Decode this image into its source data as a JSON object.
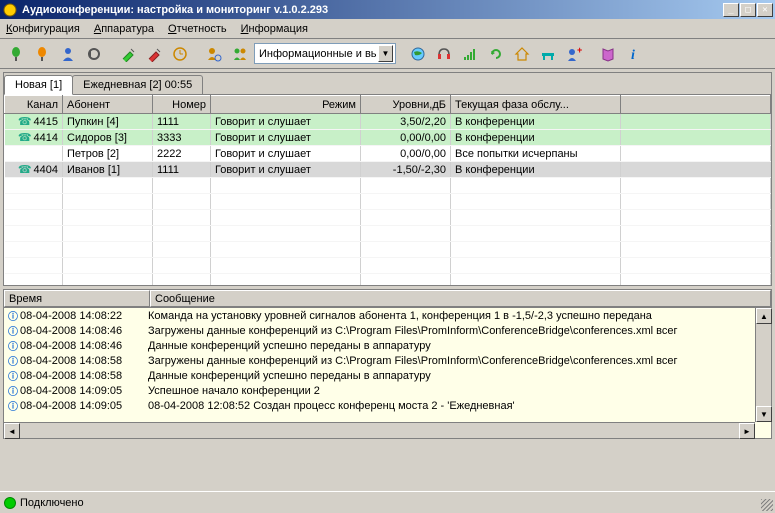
{
  "title": "Аудиоконференции: настройка и мониторинг v.1.0.2.293",
  "menu": {
    "config": "Конфигурация",
    "hardware": "Аппаратура",
    "report": "Отчетность",
    "info": "Информация"
  },
  "toolbar": {
    "combo_value": "Информационные и вь"
  },
  "tabs": [
    {
      "label": "Новая [1]",
      "active": true
    },
    {
      "label": "Ежедневная [2] 00:55",
      "active": false
    }
  ],
  "columns": {
    "channel": "Канал",
    "abonent": "Абонент",
    "number": "Номер",
    "mode": "Режим",
    "levels": "Уровни,дБ",
    "phase": "Текущая фаза обслу..."
  },
  "rows": [
    {
      "style": "green",
      "icon": true,
      "channel": "4415",
      "abonent": "Пупкин [4]",
      "number": "1111",
      "mode": "Говорит и слушает",
      "levels": "3,50/2,20",
      "phase": "В конференции"
    },
    {
      "style": "green",
      "icon": true,
      "channel": "4414",
      "abonent": "Сидоров [3]",
      "number": "3333",
      "mode": "Говорит и слушает",
      "levels": "0,00/0,00",
      "phase": "В конференции"
    },
    {
      "style": "white",
      "icon": false,
      "channel": "",
      "abonent": "Петров [2]",
      "number": "2222",
      "mode": "Говорит и слушает",
      "levels": "0,00/0,00",
      "phase": "Все попытки исчерпаны"
    },
    {
      "style": "gray",
      "icon": true,
      "channel": "4404",
      "abonent": "Иванов [1]",
      "number": "1111",
      "mode": "Говорит и слушает",
      "levels": "-1,50/-2,30",
      "phase": "В конференции"
    }
  ],
  "log_columns": {
    "time": "Время",
    "msg": "Сообщение"
  },
  "log": [
    {
      "time": "08-04-2008 14:08:22",
      "msg": "Команда на установку уровней сигналов абонента 1, конференция 1 в -1,5/-2,3 успешно передана"
    },
    {
      "time": "08-04-2008 14:08:46",
      "msg": "Загружены данные конференций из C:\\Program Files\\PromInform\\ConferenceBridge\\conferences.xml всег"
    },
    {
      "time": "08-04-2008 14:08:46",
      "msg": "Данные конференций успешно переданы в аппаратуру"
    },
    {
      "time": "08-04-2008 14:08:58",
      "msg": "Загружены данные конференций из C:\\Program Files\\PromInform\\ConferenceBridge\\conferences.xml всег"
    },
    {
      "time": "08-04-2008 14:08:58",
      "msg": "Данные конференций успешно переданы в аппаратуру"
    },
    {
      "time": "08-04-2008 14:09:05",
      "msg": "Успешное начало конференции 2"
    },
    {
      "time": "08-04-2008 14:09:05",
      "msg": "08-04-2008 12:08:52  Создан процесс конференц моста 2 - 'Ежедневная'"
    }
  ],
  "status": {
    "text": "Подключено"
  }
}
